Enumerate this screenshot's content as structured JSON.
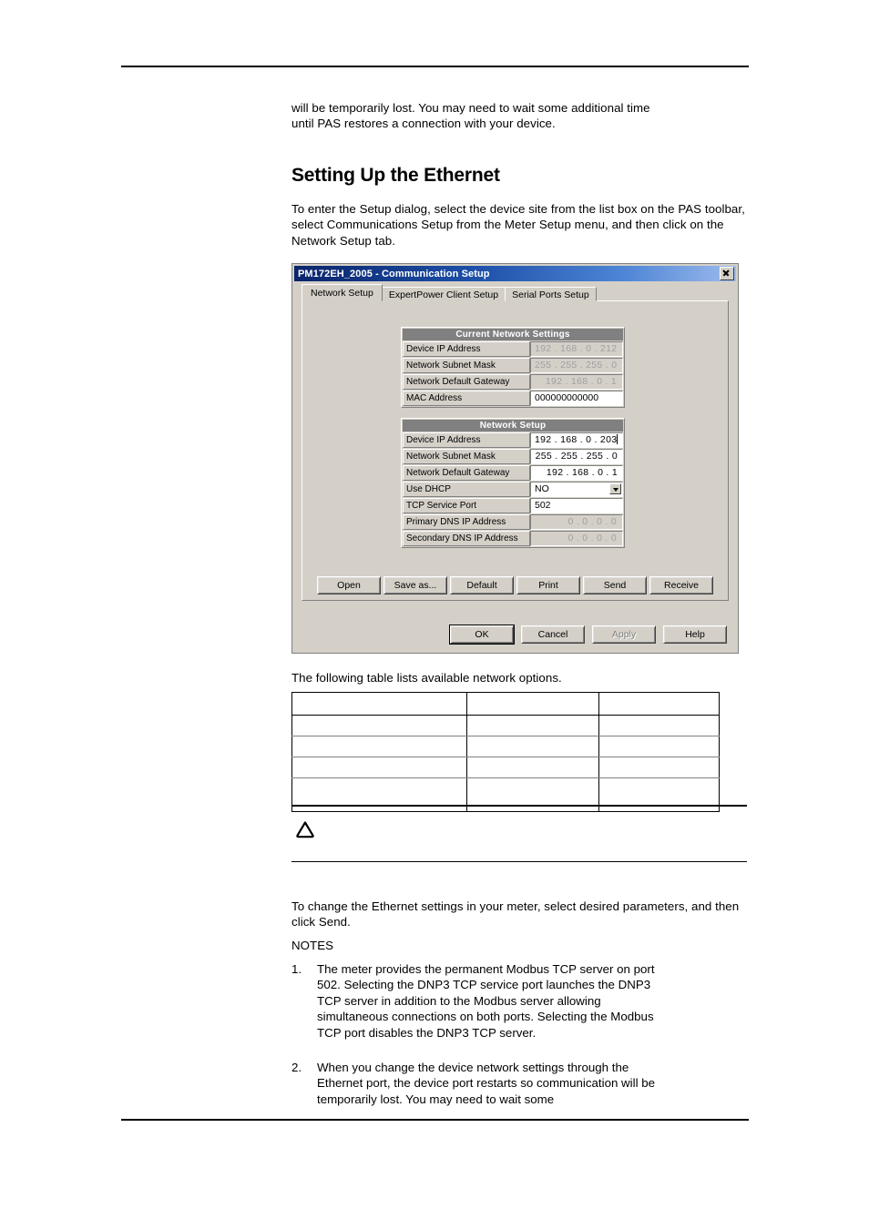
{
  "page": {
    "intro_paragraph": "will be temporarily lost. You may need to wait some additional time until PAS restores a connection with your device.",
    "section_title": "Setting Up the Ethernet",
    "setup_paragraph": "To enter the Setup dialog, select the device site from the list box on the PAS toolbar, select Communications Setup from the Meter Setup menu, and then click on the Network Setup tab.",
    "table_intro": "The following table lists available network options.",
    "change_paragraph": "To change the Ethernet settings in your meter, select desired parameters, and then click Send.",
    "notes_heading": "NOTES",
    "notes": [
      {
        "number": "1.",
        "text": "The meter provides the permanent Modbus TCP server on port 502. Selecting the DNP3 TCP service port launches the DNP3 TCP server in addition to the Modbus server allowing simultaneous connections on both ports. Selecting the Modbus TCP port disables the DNP3 TCP server."
      },
      {
        "number": "2.",
        "text": "When you change the device network settings through the Ethernet port, the device port restarts so communication will be temporarily lost. You may need to wait some"
      }
    ]
  },
  "options_table": {
    "rows": [
      [
        "",
        "",
        ""
      ],
      [
        "",
        "",
        ""
      ],
      [
        "",
        "",
        ""
      ],
      [
        "",
        "",
        ""
      ],
      [
        "",
        "",
        ""
      ]
    ]
  },
  "dialog": {
    "title": "PM172EH_2005 - Communication Setup",
    "close_icon": "close-icon",
    "tabs": [
      {
        "label": "Network Setup",
        "active": true
      },
      {
        "label": "ExpertPower Client Setup",
        "active": false
      },
      {
        "label": "Serial Ports Setup",
        "active": false
      }
    ],
    "current_network_settings": {
      "header": "Current Network Settings",
      "rows": [
        {
          "label": "Device IP Address",
          "value": "192 . 168 .  0  . 212",
          "readonly": true
        },
        {
          "label": "Network Subnet Mask",
          "value": "255 . 255 . 255 .  0",
          "readonly": true
        },
        {
          "label": "Network Default Gateway",
          "value": "192 . 168 .  0  .  1",
          "readonly": true
        },
        {
          "label": "MAC Address",
          "value": "000000000000",
          "readonly": false
        }
      ]
    },
    "network_setup": {
      "header": "Network Setup",
      "rows": [
        {
          "label": "Device IP Address",
          "value": "192 . 168 .  0  . 203",
          "type": "ip-edit-focused"
        },
        {
          "label": "Network Subnet Mask",
          "value": "255 . 255 . 255 .  0",
          "type": "ip-edit"
        },
        {
          "label": "Network Default Gateway",
          "value": "192 . 168 .  0  .  1",
          "type": "ip-edit"
        },
        {
          "label": "Use DHCP",
          "value": "NO",
          "type": "combo"
        },
        {
          "label": "TCP Service Port",
          "value": "502",
          "type": "text"
        },
        {
          "label": "Primary DNS IP Address",
          "value": " 0  .  0  .  0  .  0",
          "type": "ip-readonly"
        },
        {
          "label": "Secondary DNS IP Address",
          "value": " 0  .  0  .  0  .  0",
          "type": "ip-readonly"
        }
      ]
    },
    "action_buttons": [
      {
        "label": "Open",
        "accel": "O"
      },
      {
        "label": "Save as...",
        "accel": "a"
      },
      {
        "label": "Default",
        "accel": "D"
      },
      {
        "label": "Print",
        "accel": "r"
      },
      {
        "label": "Send",
        "accel": "S"
      },
      {
        "label": "Receive",
        "accel": "R"
      }
    ],
    "footer_buttons": [
      {
        "label": "OK",
        "state": "default"
      },
      {
        "label": "Cancel",
        "state": "normal"
      },
      {
        "label": "Apply",
        "state": "disabled"
      },
      {
        "label": "Help",
        "state": "normal"
      }
    ]
  }
}
